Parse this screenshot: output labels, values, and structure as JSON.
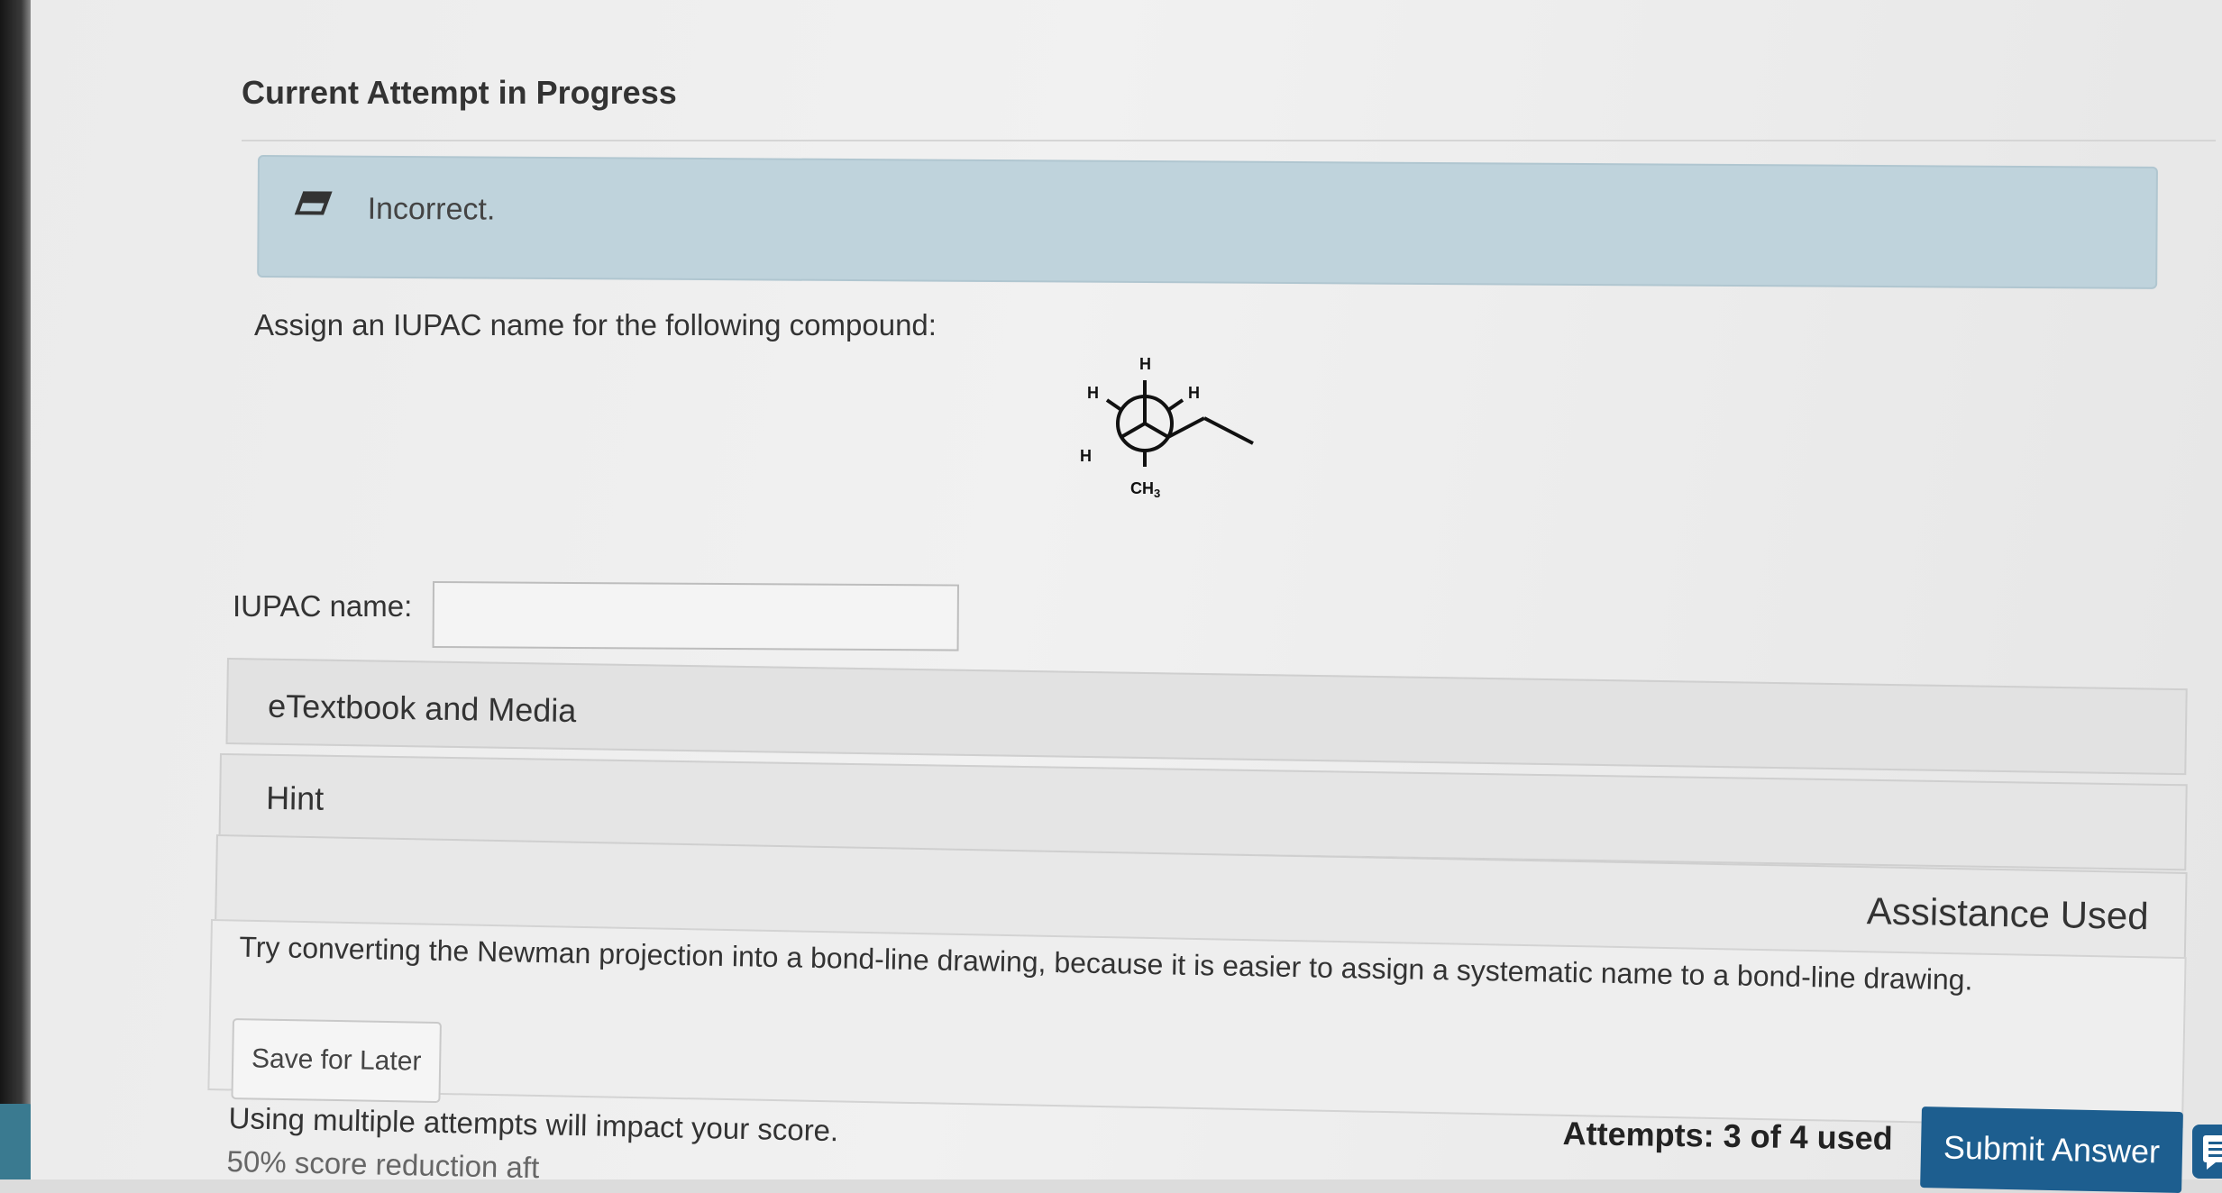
{
  "section": {
    "title": "Current Attempt in Progress"
  },
  "feedback": {
    "status": "Incorrect.",
    "icon": "eraser-icon",
    "color": "#bfd3dc"
  },
  "question": {
    "prompt": "Assign an IUPAC name for the following compound:",
    "molecule_labels": {
      "top": "H",
      "upper_left": "H",
      "upper_right": "H",
      "lower_left": "H",
      "bottom": "CH",
      "bottom_sub": "3"
    }
  },
  "answer": {
    "label": "IUPAC name:",
    "value": ""
  },
  "panels": {
    "etextbook": "eTextbook and Media",
    "hint": "Hint",
    "assistance": "Assistance Used",
    "hint_text": "Try converting the Newman projection into a bond-line drawing, because it is easier to assign a systematic name to a bond-line drawing."
  },
  "footer": {
    "save_label": "Save for Later",
    "warning": "Using multiple attempts will impact your score.",
    "penalty": "50% score reduction aft",
    "attempts": "Attempts: 3 of 4 used",
    "submit_label": "Submit Answer",
    "submit_color": "#1d5e8f"
  }
}
